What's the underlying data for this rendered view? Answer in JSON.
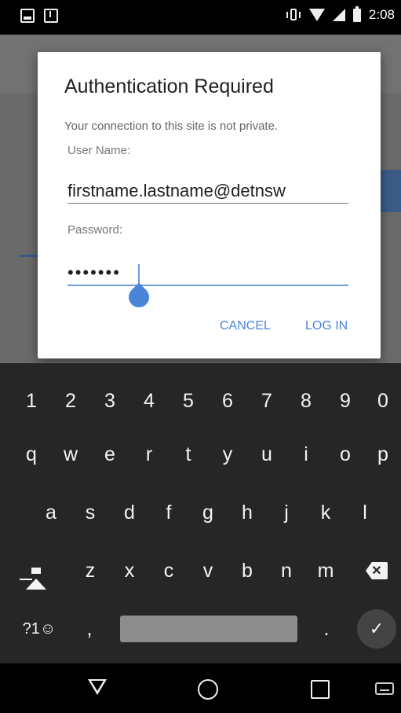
{
  "status_bar": {
    "time": "2:08"
  },
  "dialog": {
    "title": "Authentication Required",
    "message": "Your connection to this site is not private.",
    "username_label": "User Name:",
    "username_value": "firstname.lastname@detnsw",
    "password_label": "Password:",
    "password_value": "•••••••",
    "cancel_label": "CANCEL",
    "login_label": "LOG IN"
  },
  "keyboard": {
    "row1": [
      "1",
      "2",
      "3",
      "4",
      "5",
      "6",
      "7",
      "8",
      "9",
      "0"
    ],
    "row2": [
      "q",
      "w",
      "e",
      "r",
      "t",
      "y",
      "u",
      "i",
      "o",
      "p"
    ],
    "row3": [
      "a",
      "s",
      "d",
      "f",
      "g",
      "h",
      "j",
      "k",
      "l"
    ],
    "row4": [
      "z",
      "x",
      "c",
      "v",
      "b",
      "n",
      "m"
    ],
    "symbols_label": "?1☺",
    "comma_label": ",",
    "period_label": ".",
    "done_label": "✓"
  },
  "icons": {
    "status_left": [
      "image-notification-icon",
      "download-notification-icon"
    ],
    "status_right": [
      "vibrate-icon",
      "wifi-icon",
      "signal-icon",
      "battery-icon"
    ],
    "nav": [
      "back-icon",
      "home-icon",
      "recent-apps-icon",
      "keyboard-switch-icon"
    ]
  },
  "colors": {
    "accent": "#4a86d8",
    "keyboard_bg": "#262626",
    "dialog_bg": "#ffffff"
  }
}
